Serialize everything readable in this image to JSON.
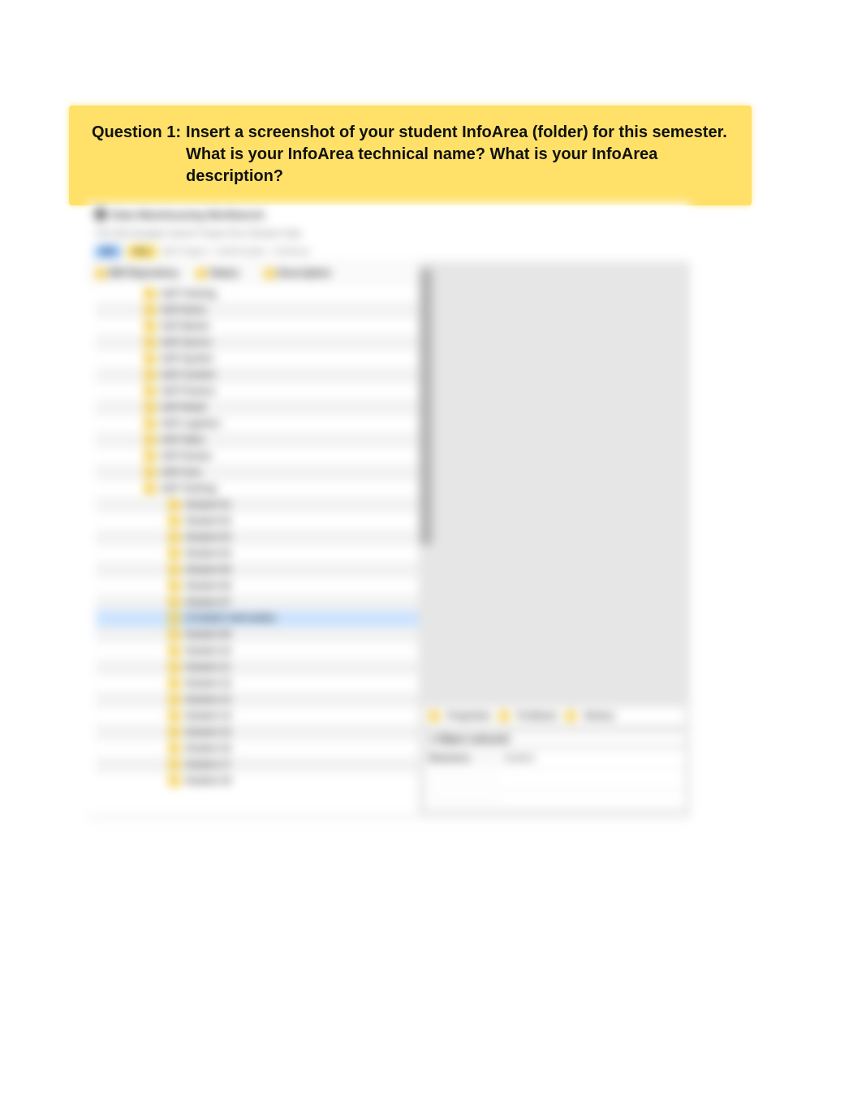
{
  "question": {
    "label": "Question 1:",
    "text": "Insert a screenshot of your student InfoArea (folder) for this semester. What is your InfoArea technical name? What is your InfoArea description?"
  },
  "screenshot": {
    "window_title": "Data Warehousing Workbench",
    "menu_line": "File  Edit  Navigate  Search  Project  Run  Window  Help",
    "toolbar": {
      "chip1": "BW",
      "chip2": "Run",
      "path_text": "BW Project > InfoProvider > InfoArea"
    },
    "tree_headers": {
      "col1": "BW Repository",
      "col2": "Status",
      "col3": "Description"
    },
    "nodes_level1": [
      "SAP Training",
      "SAP Demo",
      "SAP Master",
      "SAP Source",
      "SAP System",
      "SAP Content",
      "SAP Finance",
      "SAP Retail",
      "SAP Logistics",
      "SAP Sales",
      "SAP Human",
      "SAP Area",
      "SAP Training"
    ],
    "nodes_level2": [
      "Student 01",
      "Student 02",
      "Student 03",
      "Student 04",
      "Student 05",
      "Student 06",
      "Student 07",
      "STUDENT INFOAREA",
      "Student 09",
      "Student 10",
      "Student 11",
      "Student 12",
      "Student 13",
      "Student 14",
      "Student 15",
      "Student 16",
      "Student 17",
      "Student 18"
    ],
    "selected_index": 7,
    "properties": {
      "bar_items": [
        "Properties",
        "Problems",
        "History"
      ],
      "panel_title": "1 Object selected",
      "rows": [
        {
          "k": "Resource",
          "v": "Student"
        }
      ]
    }
  }
}
